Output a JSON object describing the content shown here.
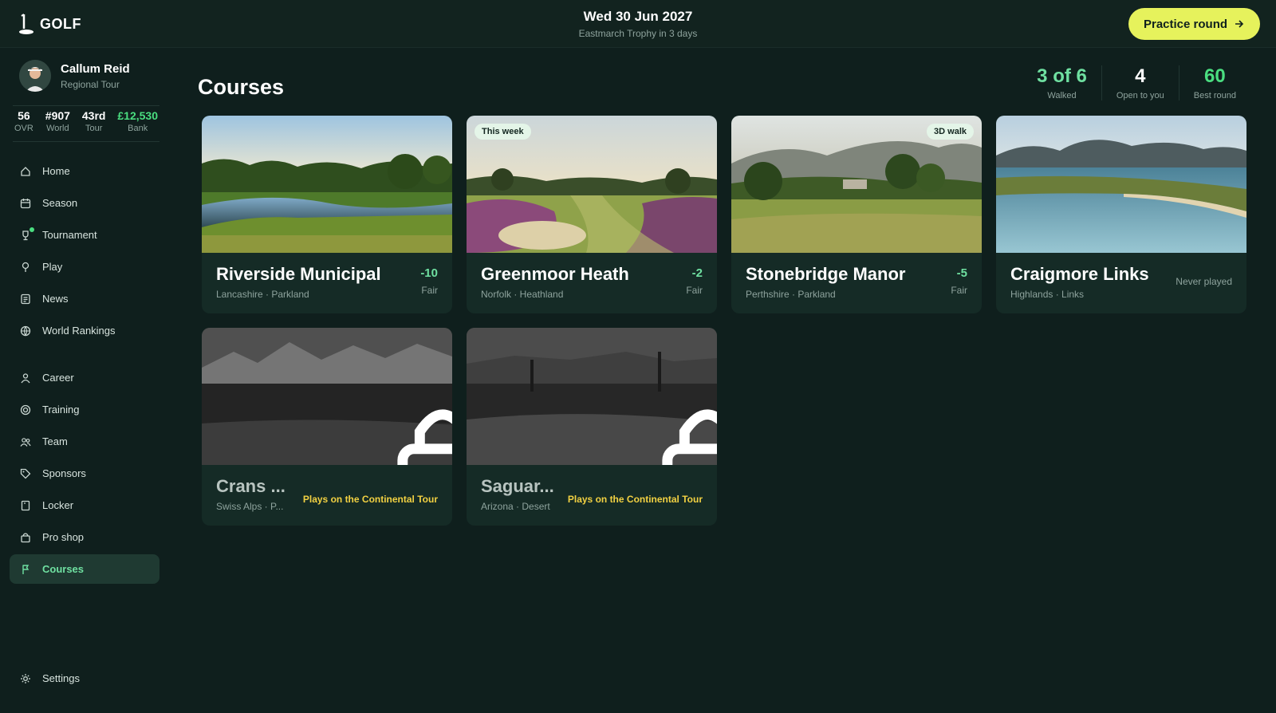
{
  "header": {
    "app_name": "GOLF",
    "date": "Wed 30 Jun 2027",
    "subtitle": "Eastmarch Trophy in 3 days",
    "practice_label": "Practice round"
  },
  "profile": {
    "name": "Callum Reid",
    "tour": "Regional Tour",
    "stats": [
      {
        "value": "56",
        "label": "OVR"
      },
      {
        "value": "#907",
        "label": "World"
      },
      {
        "value": "43rd",
        "label": "Tour"
      },
      {
        "value": "£12,530",
        "label": "Bank"
      }
    ]
  },
  "nav": {
    "primary": [
      {
        "label": "Home",
        "icon": "home-icon"
      },
      {
        "label": "Season",
        "icon": "calendar-icon"
      },
      {
        "label": "Tournament",
        "icon": "trophy-icon"
      },
      {
        "label": "Play",
        "icon": "golf-ball-icon"
      },
      {
        "label": "News",
        "icon": "news-icon"
      },
      {
        "label": "World Rankings",
        "icon": "globe-icon"
      }
    ],
    "secondary": [
      {
        "label": "Career",
        "icon": "user-icon"
      },
      {
        "label": "Training",
        "icon": "target-icon"
      },
      {
        "label": "Team",
        "icon": "team-icon"
      },
      {
        "label": "Sponsors",
        "icon": "tag-icon"
      },
      {
        "label": "Locker",
        "icon": "locker-icon"
      },
      {
        "label": "Pro shop",
        "icon": "shop-icon"
      },
      {
        "label": "Courses",
        "icon": "flag-icon",
        "active": true
      }
    ],
    "settings": "Settings"
  },
  "page": {
    "title": "Courses",
    "summary": [
      {
        "value": "3 of 6",
        "label": "Walked"
      },
      {
        "value": "4",
        "label": "Open to you"
      },
      {
        "value": "60",
        "label": "Best round"
      }
    ]
  },
  "courses": [
    {
      "name": "Riverside Municipal",
      "location": "Lancashire · Parkland",
      "score": "-10",
      "grade": "Fair"
    },
    {
      "name": "Greenmoor Heath",
      "location": "Norfolk · Heathland",
      "score": "-2",
      "grade": "Fair",
      "tag": "This week"
    },
    {
      "name": "Stonebridge Manor",
      "location": "Perthshire · Parkland",
      "score": "-5",
      "grade": "Fair",
      "tag": "3D walk"
    },
    {
      "name": "Craigmore Links",
      "location": "Highlands · Links",
      "status": "Never played"
    },
    {
      "name": "Crans ...",
      "location": "Swiss Alps · P...",
      "locked_note": "Plays on the Continental Tour"
    },
    {
      "name": "Saguar...",
      "location": "Arizona · Desert",
      "locked_note": "Plays on the Continental Tour"
    }
  ],
  "colors": {
    "accent": "#e6f25c",
    "positive": "#4ade80",
    "warning": "#f2d142",
    "background": "#0f1f1d"
  }
}
